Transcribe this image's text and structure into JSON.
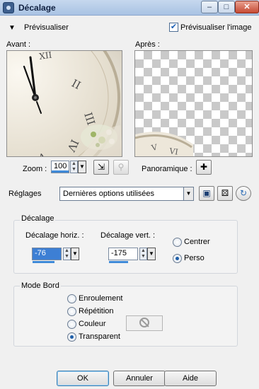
{
  "window": {
    "title": "Décalage"
  },
  "preview": {
    "section_label": "Prévisualiser",
    "preview_image_label": "Prévisualiser l'image",
    "preview_image_checked": true,
    "before_label": "Avant :",
    "after_label": "Après :"
  },
  "zoom": {
    "label": "Zoom :",
    "value": "100",
    "pan_label": "Panoramique :"
  },
  "presets": {
    "label": "Réglages",
    "selected": "Dernières options utilisées"
  },
  "offset": {
    "group_title": "Décalage",
    "horizontal_label": "Décalage horiz. :",
    "horizontal_value": "-76",
    "vertical_label": "Décalage vert. :",
    "vertical_value": "-175",
    "mode_center_label": "Centrer",
    "mode_custom_label": "Perso",
    "selected_mode": "Perso"
  },
  "edge_mode": {
    "group_title": "Mode Bord",
    "options": [
      "Enroulement",
      "Répétition",
      "Couleur",
      "Transparent"
    ],
    "selected": "Transparent"
  },
  "buttons": {
    "ok": "OK",
    "cancel": "Annuler",
    "help": "Aide"
  },
  "icons": {
    "close": "close-icon",
    "minimize": "minimize-icon",
    "maximize": "maximize-icon",
    "collapse": "triangle-down-icon",
    "zoom_fit": "zoom-fit-icon",
    "zoom_actual": "zoom-actual-icon",
    "pan": "move-cross-icon",
    "save": "floppy-disk-icon",
    "random": "dice-icon",
    "reset": "reset-icon",
    "no_color": "no-color-icon"
  },
  "colors": {
    "accent": "#3f8ad8",
    "titlebar": "#a9c3e3"
  }
}
